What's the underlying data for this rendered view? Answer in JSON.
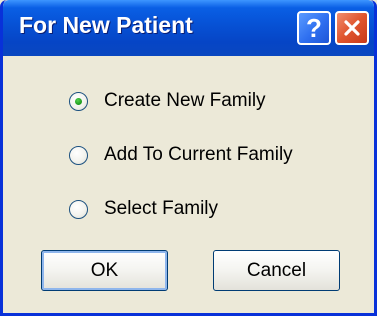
{
  "window": {
    "title": "For New Patient",
    "help_label": "?"
  },
  "options": [
    {
      "label": "Create New Family",
      "checked": true
    },
    {
      "label": "Add To Current Family",
      "checked": false
    },
    {
      "label": "Select Family",
      "checked": false
    }
  ],
  "buttons": {
    "ok_label": "OK",
    "cancel_label": "Cancel"
  },
  "colors": {
    "titlebar": "#0A5FE5",
    "dialog_bg": "#ECE9D8",
    "close_button": "#E0552E",
    "radio_dot": "#21A121"
  }
}
